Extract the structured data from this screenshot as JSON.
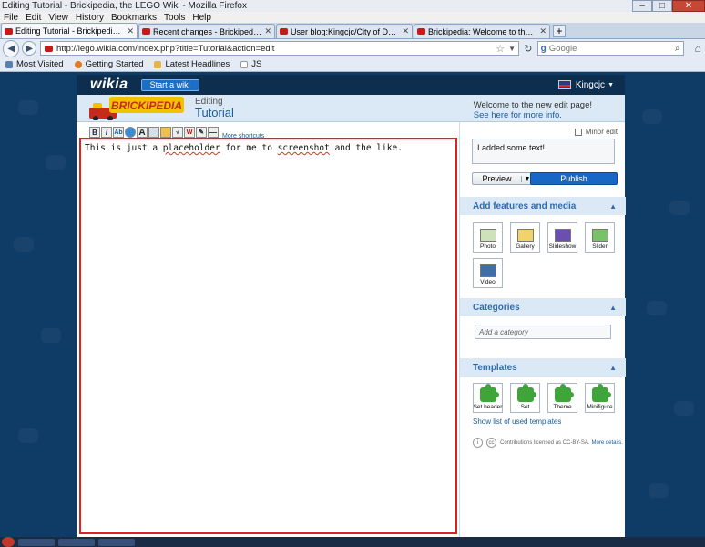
{
  "window": {
    "title": "Editing Tutorial - Brickipedia, the LEGO Wiki - Mozilla Firefox",
    "minimize": "–",
    "maximize": "□",
    "close": "✕"
  },
  "menu": [
    "File",
    "Edit",
    "View",
    "History",
    "Bookmarks",
    "Tools",
    "Help"
  ],
  "tabs": [
    {
      "label": "Editing Tutorial - Brickipedia, the LEG...",
      "active": true
    },
    {
      "label": "Recent changes - Brickipedia, the LE...",
      "active": false
    },
    {
      "label": "User blog:Kingcjc/City of Delusion - ...",
      "active": false
    },
    {
      "label": "Brickipedia: Welcome to the Brickipe...",
      "active": false
    }
  ],
  "navbar": {
    "url": "http://lego.wikia.com/index.php?title=Tutorial&action=edit",
    "search_placeholder": "Google"
  },
  "bookmarks": [
    "Most Visited",
    "Getting Started",
    "Latest Headlines",
    "JS"
  ],
  "wiki": {
    "logo": "wikia",
    "start_wiki": "Start a wiki",
    "username": "Kingcjc",
    "site_logo_text": "BRICKIPEDIA",
    "editing_label": "Editing",
    "page_name": "Tutorial",
    "welcome_line": "Welcome to the new edit page!",
    "welcome_link": "See here for more info."
  },
  "editor": {
    "more_shortcuts": "More shortcuts",
    "content_before": "This is just a ",
    "content_word1": "placeholder",
    "content_mid": " for me to ",
    "content_word2": "screenshot",
    "content_after": " and the like."
  },
  "sidebar": {
    "minor_edit": "Minor edit",
    "summary": "I added some text!",
    "preview": "Preview",
    "publish": "Publish",
    "features_title": "Add features and media",
    "media": [
      "Photo",
      "Gallery",
      "Slideshow",
      "Slider",
      "Video"
    ],
    "categories_title": "Categories",
    "category_placeholder": "Add a category",
    "templates_title": "Templates",
    "templates": [
      "Set header",
      "Set",
      "Theme",
      "Minifigure"
    ],
    "show_templates": "Show list of used templates",
    "license_text": "Contributions licensed as CC-BY-SA.",
    "license_link": "More details."
  },
  "colors": {
    "wiki_header": "#0d2e4f",
    "accent_blue": "#1867c4",
    "focus_border": "#e02121",
    "section_bg": "#dbe9f6"
  }
}
